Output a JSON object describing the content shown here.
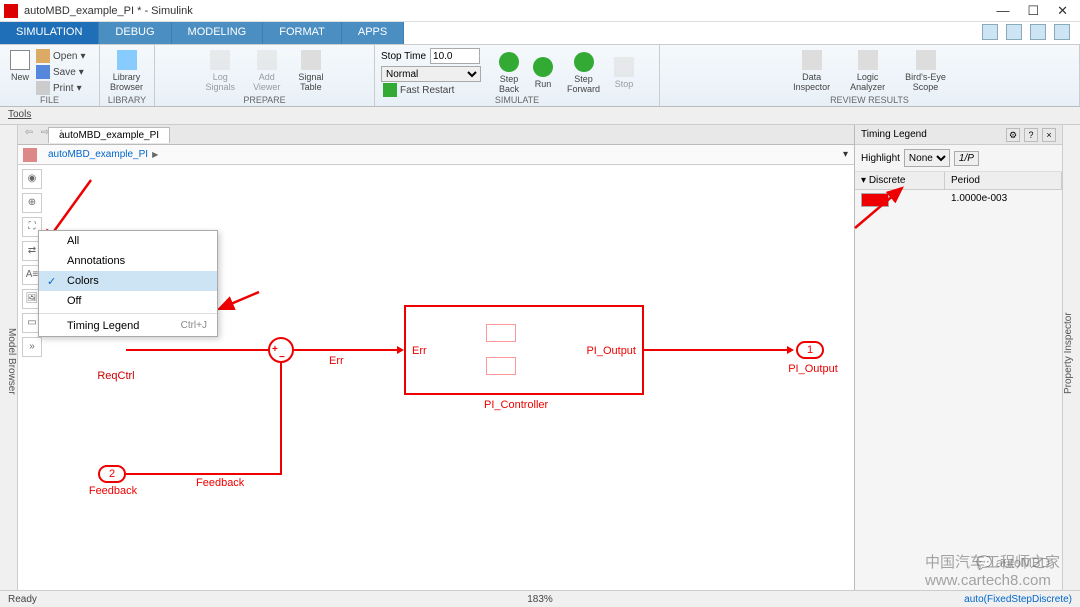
{
  "window": {
    "title": "autoMBD_example_PI * - Simulink",
    "min": "—",
    "max": "☐",
    "close": "✕"
  },
  "tabs": {
    "simulation": "SIMULATION",
    "debug": "DEBUG",
    "modeling": "MODELING",
    "format": "FORMAT",
    "apps": "APPS"
  },
  "ribbon": {
    "new": "New",
    "open": "Open",
    "save": "Save",
    "print": "Print",
    "file": "FILE",
    "library_browser": "Library\nBrowser",
    "library": "LIBRARY",
    "log_signals": "Log\nSignals",
    "add_viewer": "Add\nViewer",
    "signal_table": "Signal\nTable",
    "prepare": "PREPARE",
    "stop_time": "Stop Time",
    "stop_time_val": "10.0",
    "normal": "Normal",
    "fast_restart": "Fast Restart",
    "step_back": "Step\nBack",
    "run": "Run",
    "step_forward": "Step\nForward",
    "stop": "Stop",
    "simulate": "SIMULATE",
    "data_inspector": "Data\nInspector",
    "logic_analyzer": "Logic\nAnalyzer",
    "birds_eye": "Bird's-Eye\nScope",
    "review": "REVIEW RESULTS"
  },
  "tools_label": "Tools",
  "side_panels": {
    "model_browser": "Model Browser",
    "property_inspector": "Property Inspector"
  },
  "document": {
    "tab": "autoMBD_example_PI",
    "breadcrumb": "autoMBD_example_PI",
    "breadcrumb_arrow": "▶"
  },
  "context_menu": {
    "items": [
      "All",
      "Annotations",
      "Colors",
      "Off",
      "Timing Legend"
    ],
    "shortcut": "Ctrl+J",
    "selected": "Colors"
  },
  "diagram": {
    "reqctrl": "ReqCtrl",
    "feedback": "Feedback",
    "feedback_num": "2",
    "err": "Err",
    "pi_controller": "PI_Controller",
    "pi_output": "PI_Output",
    "pi_output_num": "1",
    "sub_err": "Err",
    "sub_out": "PI_Output"
  },
  "timing": {
    "title": "Timing Legend",
    "highlight": "Highlight",
    "highlight_val": "None",
    "vp": "1/P",
    "discrete": "Discrete",
    "period": "Period",
    "period_val": "1.0000e-003"
  },
  "status": {
    "ready": "Ready",
    "zoom": "183%",
    "mode": "auto(FixedStepDiscrete)"
  },
  "watermark1": "中国汽车工程师之家",
  "watermark2": "www.cartech8.com",
  "watermark3": "autoMBD"
}
